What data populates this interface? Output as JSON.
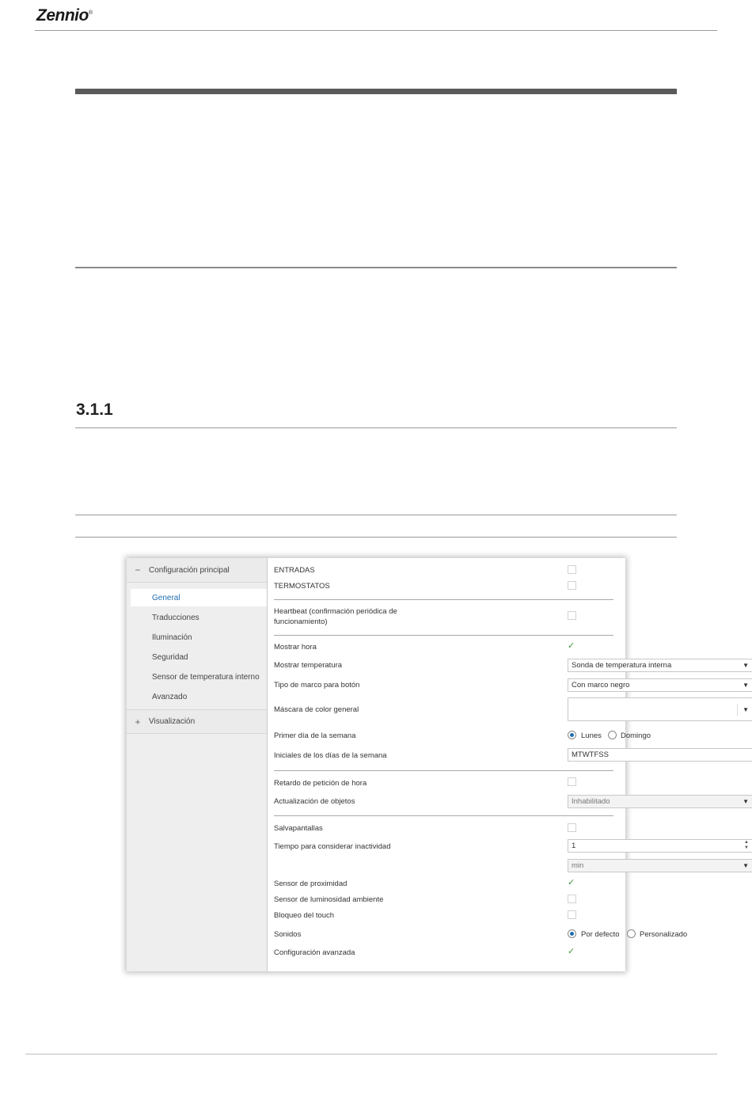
{
  "brand": {
    "name": "Zennio",
    "mark": "®"
  },
  "section": {
    "number": "3.1.1"
  },
  "sidebar": {
    "groups": [
      {
        "toggle": "−",
        "label": "Configuración principal"
      },
      {
        "toggle": "+",
        "label": "Visualización"
      }
    ],
    "items": [
      {
        "label": "General",
        "selected": true
      },
      {
        "label": "Traducciones"
      },
      {
        "label": "Iluminación"
      },
      {
        "label": "Seguridad"
      },
      {
        "label": "Sensor de temperatura interno"
      },
      {
        "label": "Avanzado"
      }
    ]
  },
  "form": {
    "entradas": {
      "label": "ENTRADAS",
      "checked": false
    },
    "termostatos": {
      "label": "TERMOSTATOS",
      "checked": false
    },
    "heartbeat": {
      "label_line1": "Heartbeat (confirmación periódica de",
      "label_line2": "funcionamiento)",
      "checked": false
    },
    "mostrar_hora": {
      "label": "Mostrar hora",
      "checked": true
    },
    "mostrar_temperatura": {
      "label": "Mostrar temperatura",
      "value": "Sonda de temperatura interna"
    },
    "tipo_marco": {
      "label": "Tipo de marco para botón",
      "value": "Con marco negro"
    },
    "mascara_color": {
      "label": "Máscara de color general",
      "value": ""
    },
    "primer_dia": {
      "label": "Primer día de la semana",
      "options": [
        "Lunes",
        "Domingo"
      ],
      "selected": "Lunes"
    },
    "iniciales": {
      "label": "Iniciales de los días de la semana",
      "value": "MTWTFSS"
    },
    "retardo": {
      "label": "Retardo de petición de hora",
      "checked": false
    },
    "actualizacion": {
      "label": "Actualización de objetos",
      "value": "Inhabilitado"
    },
    "salvapantallas": {
      "label": "Salvapantallas",
      "checked": false
    },
    "tiempo_inactividad": {
      "label": "Tiempo para considerar inactividad",
      "value": "1",
      "unit": "min"
    },
    "sensor_proximidad": {
      "label": "Sensor de proximidad",
      "checked": true
    },
    "sensor_luminosidad": {
      "label": "Sensor de luminosidad ambiente",
      "checked": false
    },
    "bloqueo_touch": {
      "label": "Bloqueo del touch",
      "checked": false
    },
    "sonidos": {
      "label": "Sonidos",
      "options": [
        "Por defecto",
        "Personalizado"
      ],
      "selected": "Por defecto"
    },
    "config_avanzada": {
      "label": "Configuración avanzada",
      "checked": true
    }
  },
  "colors": {
    "accent": "#1f6fb3",
    "check": "#3f9a3f",
    "sidebar_bg": "#eeeeee"
  }
}
